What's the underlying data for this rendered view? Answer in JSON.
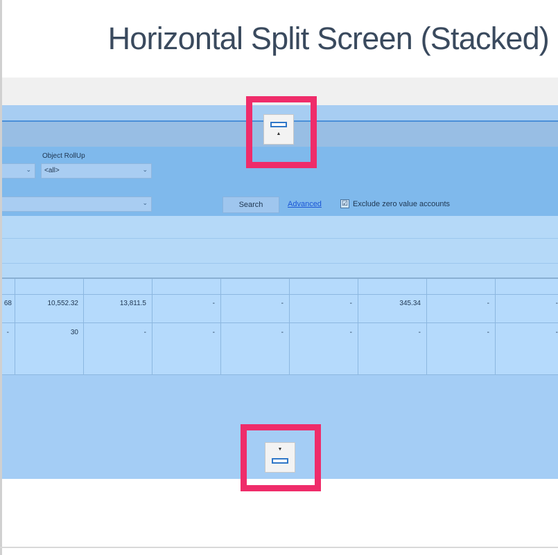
{
  "slide": {
    "title": "Horizontal Split Screen (Stacked)"
  },
  "filters": {
    "object_rollup_label": "Object RollUp",
    "object_rollup_value": "<all>",
    "first_select_value": "",
    "second_select_value": "",
    "search_label": "Search",
    "advanced_label": "Advanced",
    "exclude_zero_checked": "☑",
    "exclude_zero_label": "Exclude zero value accounts"
  },
  "grid": {
    "rows": [
      [
        "68",
        "10,552.32",
        "13,811.5",
        "-",
        "-",
        "-",
        "345.34",
        "-",
        "-"
      ],
      [
        "-",
        "30",
        "-",
        "-",
        "-",
        "-",
        "-",
        "-",
        "-"
      ]
    ]
  },
  "icons": {
    "top": "pane-collapse-up-icon",
    "bottom": "pane-collapse-down-icon",
    "highlight_color": "#ef2c6a"
  }
}
